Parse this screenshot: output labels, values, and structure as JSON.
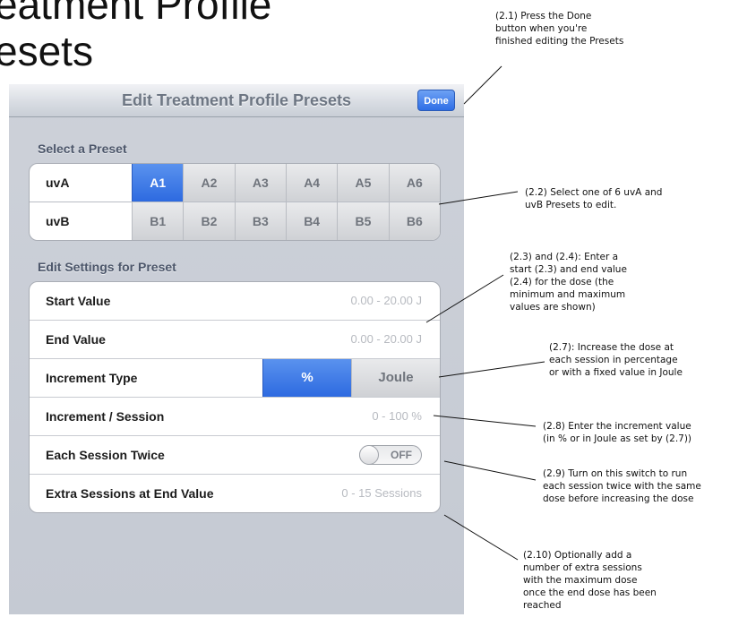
{
  "slide": {
    "title_line1": "eatment Profile",
    "title_line2": "esets"
  },
  "navbar": {
    "title": "Edit Treatment Profile Presets",
    "done_label": "Done"
  },
  "select_preset": {
    "header": "Select a Preset",
    "rows": [
      {
        "label": "uvA",
        "options": [
          "A1",
          "A2",
          "A3",
          "A4",
          "A5",
          "A6"
        ],
        "selected": "A1"
      },
      {
        "label": "uvB",
        "options": [
          "B1",
          "B2",
          "B3",
          "B4",
          "B5",
          "B6"
        ],
        "selected": ""
      }
    ]
  },
  "settings": {
    "header": "Edit Settings for Preset",
    "start_value": {
      "label": "Start Value",
      "placeholder": "0.00 - 20.00 J"
    },
    "end_value": {
      "label": "End Value",
      "placeholder": "0.00 - 20.00 J"
    },
    "increment_type": {
      "label": "Increment Type",
      "options": [
        "%",
        "Joule"
      ],
      "selected": "%"
    },
    "increment_session": {
      "label": "Increment / Session",
      "placeholder": "0 - 100 %"
    },
    "each_session_twice": {
      "label": "Each Session Twice",
      "state": "OFF"
    },
    "extra_sessions": {
      "label": "Extra Sessions at End Value",
      "placeholder": "0 - 15 Sessions"
    }
  },
  "annotations": [
    {
      "id": "2.1",
      "lines": [
        "(2.1) Press the Done",
        "button when you're",
        "finished editing the Presets"
      ]
    },
    {
      "id": "2.2",
      "lines": [
        "(2.2) Select one of 6 uvA and",
        "uvB Presets to edit."
      ]
    },
    {
      "id": "2.3",
      "lines": [
        "(2.3) and (2.4): Enter a",
        "start (2.3) and end value",
        "(2.4) for the dose (the",
        "minimum and maximum",
        "values are shown)"
      ]
    },
    {
      "id": "2.7",
      "lines": [
        "(2.7): Increase the dose at",
        "each session in percentage",
        "or with a fixed value in Joule"
      ]
    },
    {
      "id": "2.8",
      "lines": [
        "(2.8) Enter the increment value",
        "(in % or in Joule as set by (2.7))"
      ]
    },
    {
      "id": "2.9",
      "lines": [
        "(2.9) Turn on this switch to run",
        "each session twice with the same",
        "dose before increasing the dose"
      ]
    },
    {
      "id": "2.10",
      "lines": [
        "(2.10) Optionally add a",
        "number of extra sessions",
        "with the maximum dose",
        "once the end dose has been",
        "reached"
      ]
    }
  ]
}
